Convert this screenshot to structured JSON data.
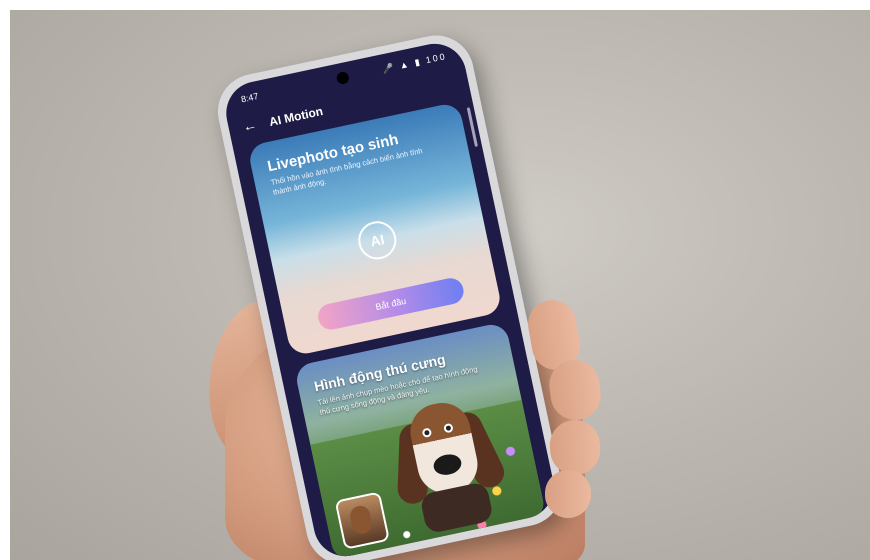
{
  "status_bar": {
    "time": "8:47",
    "icons": "🎤 ▲ ▮ 100"
  },
  "app_bar": {
    "back_glyph": "←",
    "title": "AI Motion"
  },
  "card_livephoto": {
    "title": "Livephoto tạo sinh",
    "description": "Thổi hồn vào ảnh tĩnh bằng cách biến ảnh tĩnh thành ảnh động.",
    "icon_label": "AI",
    "button_label": "Bắt đầu"
  },
  "card_pet": {
    "title": "Hình động thú cưng",
    "description": "Tải lên ảnh chụp mèo hoặc chó để tạo hình động thú cưng sống động và đáng yêu."
  },
  "colors": {
    "screen_bg": "#1e1b46",
    "button_gradient_start": "#f3a4c6",
    "button_gradient_end": "#6d7ff2"
  }
}
